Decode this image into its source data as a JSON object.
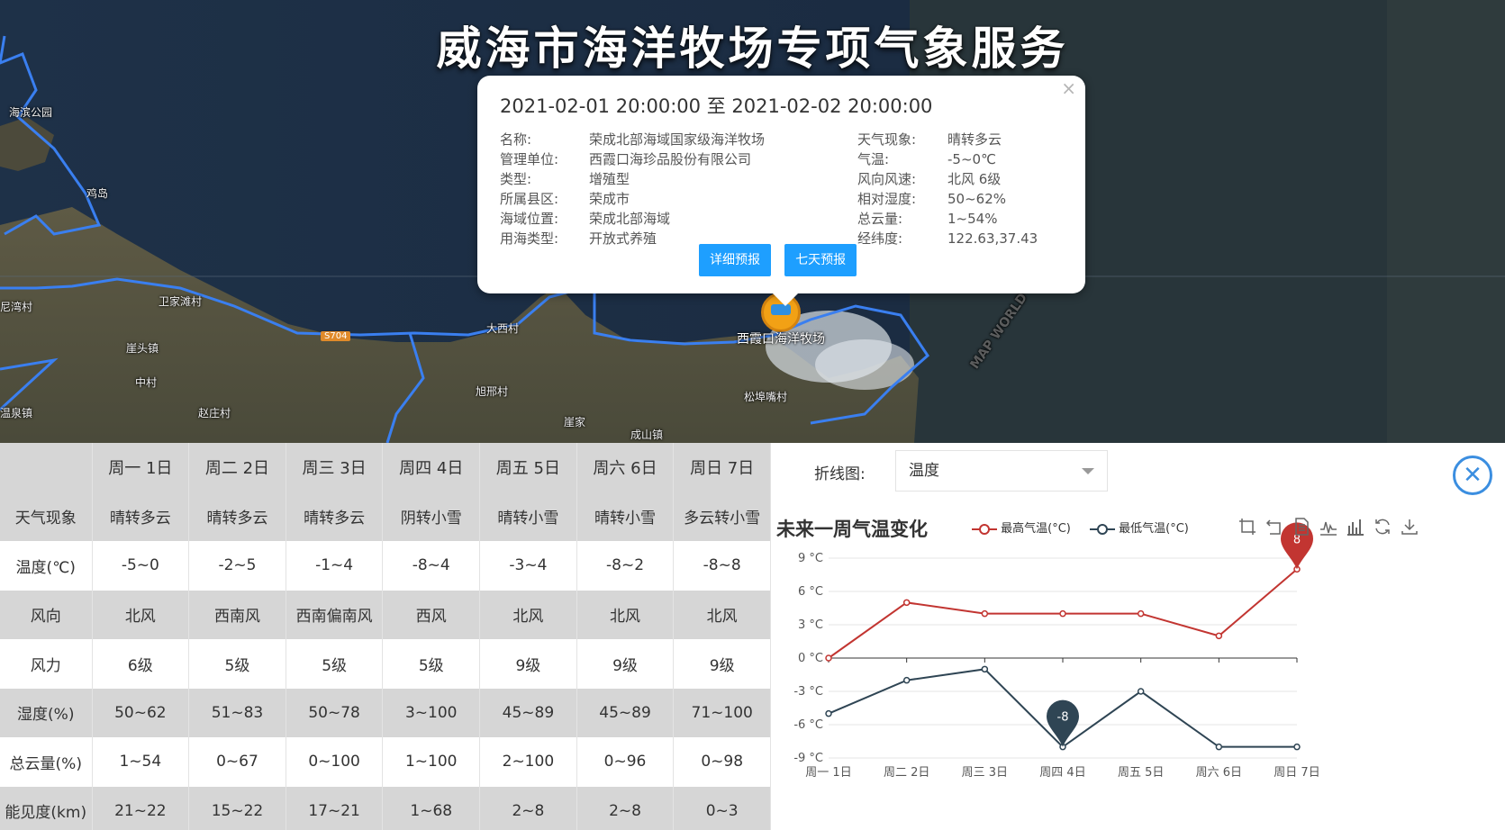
{
  "page": {
    "title": "威海市海洋牧场专项气象服务"
  },
  "map": {
    "labels": [
      "海滨公园",
      "鸡岛",
      "尼湾村",
      "卫家滩村",
      "崖头镇",
      "中村",
      "温泉镇",
      "赵庄村",
      "大西村",
      "旭邢村",
      "松埠嘴村",
      "崖家",
      "成山镇"
    ],
    "road_badge": "S704",
    "marker_label": "西霞口海洋牧场",
    "watermark": "MAP WORLD"
  },
  "popup": {
    "time_range": "2021-02-01 20:00:00 至 2021-02-02 20:00:00",
    "close": "×",
    "left_info": [
      {
        "key": "名称:",
        "value": "荣成北部海域国家级海洋牧场"
      },
      {
        "key": "管理单位:",
        "value": "西霞口海珍品股份有限公司"
      },
      {
        "key": "类型:",
        "value": "增殖型"
      },
      {
        "key": "所属县区:",
        "value": "荣成市"
      },
      {
        "key": "海域位置:",
        "value": "荣成北部海域"
      },
      {
        "key": "用海类型:",
        "value": "开放式养殖"
      }
    ],
    "right_info": [
      {
        "key": "天气现象:",
        "value": "晴转多云"
      },
      {
        "key": "气温:",
        "value": "-5~0℃"
      },
      {
        "key": "风向风速:",
        "value": "北风 6级"
      },
      {
        "key": "相对湿度:",
        "value": "50~62%"
      },
      {
        "key": "总云量:",
        "value": "1~54%"
      },
      {
        "key": "经纬度:",
        "value": "122.63,37.43"
      }
    ],
    "buttons": {
      "detail": "详细预报",
      "seven_day": "七天预报"
    }
  },
  "table": {
    "headers": [
      "",
      "周一 1日",
      "周二 2日",
      "周三 3日",
      "周四 4日",
      "周五 5日",
      "周六 6日",
      "周日 7日"
    ],
    "rows": [
      {
        "label": "天气现象",
        "cells": [
          "晴转多云",
          "晴转多云",
          "晴转多云",
          "阴转小雪",
          "晴转小雪",
          "晴转小雪",
          "多云转小雪"
        ]
      },
      {
        "label": "温度(℃)",
        "cells": [
          "-5~0",
          "-2~5",
          "-1~4",
          "-8~4",
          "-3~4",
          "-8~2",
          "-8~8"
        ]
      },
      {
        "label": "风向",
        "cells": [
          "北风",
          "西南风",
          "西南偏南风",
          "西风",
          "北风",
          "北风",
          "北风"
        ]
      },
      {
        "label": "风力",
        "cells": [
          "6级",
          "5级",
          "5级",
          "5级",
          "9级",
          "9级",
          "9级"
        ]
      },
      {
        "label": "湿度(%)",
        "cells": [
          "50~62",
          "51~83",
          "50~78",
          "3~100",
          "45~89",
          "45~89",
          "71~100"
        ]
      },
      {
        "label": "总云量(%)",
        "cells": [
          "1~54",
          "0~67",
          "0~100",
          "1~100",
          "2~100",
          "0~96",
          "0~98"
        ]
      },
      {
        "label": "能见度(km)",
        "cells": [
          "21~22",
          "15~22",
          "17~21",
          "1~68",
          "2~8",
          "2~8",
          "0~3"
        ]
      }
    ]
  },
  "chart_panel": {
    "type_label": "折线图:",
    "select_value": "温度",
    "close": "✕"
  },
  "chart_data": {
    "type": "line",
    "title": "未来一周气温变化",
    "categories": [
      "周一 1日",
      "周二 2日",
      "周三 3日",
      "周四 4日",
      "周五 5日",
      "周六 6日",
      "周日 7日"
    ],
    "series": [
      {
        "name": "最高气温(°C)",
        "values": [
          0,
          5,
          4,
          4,
          4,
          2,
          8
        ],
        "color": "#c23531",
        "max_label": "8"
      },
      {
        "name": "最低气温(°C)",
        "values": [
          -5,
          -2,
          -1,
          -8,
          -3,
          -8,
          -8
        ],
        "color": "#2f4554",
        "min_label": "-8"
      }
    ],
    "yticks": [
      "9 °C",
      "6 °C",
      "3 °C",
      "0 °C",
      "-3 °C",
      "-6 °C",
      "-9 °C"
    ],
    "ylim": [
      -9,
      9
    ],
    "legend": "top-right",
    "toolbox_icons": [
      "zoom-icon",
      "zoom-reset-icon",
      "data-view-icon",
      "line-switch-icon",
      "bar-switch-icon",
      "restore-icon",
      "save-image-icon"
    ]
  }
}
